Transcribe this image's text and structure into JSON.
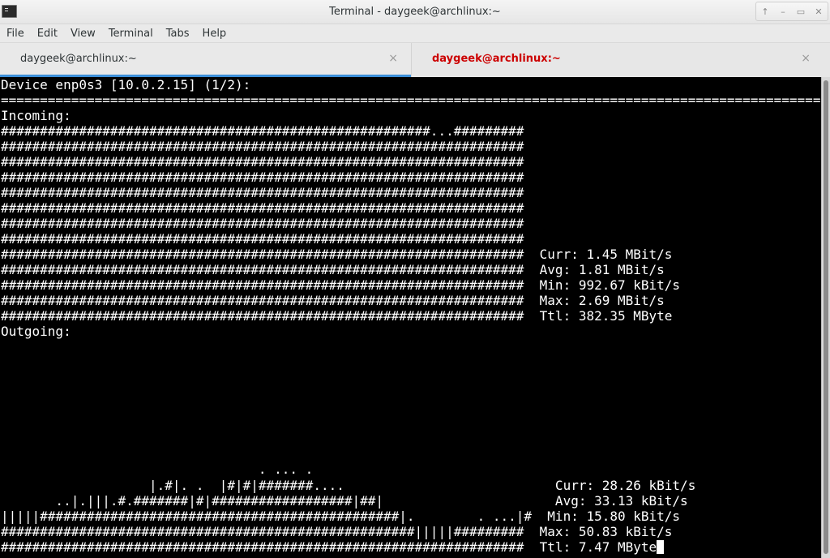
{
  "window": {
    "title": "Terminal - daygeek@archlinux:~",
    "controls": [
      "↑",
      "–",
      "▭",
      "✕"
    ]
  },
  "menubar": {
    "items": [
      "File",
      "Edit",
      "View",
      "Terminal",
      "Tabs",
      "Help"
    ]
  },
  "tabs": [
    {
      "label": "daygeek@archlinux:~",
      "active": true
    },
    {
      "label": "daygeek@archlinux:~",
      "active": false,
      "color": "#cc0000"
    }
  ],
  "tab_close_glyph": "×",
  "terminal": {
    "foreground": "#ffffff",
    "background": "#000000",
    "lines": [
      "Device enp0s3 [10.0.2.15] (1/2):",
      "================================================================================================================",
      "Incoming:",
      "#######################################################...#########",
      "###################################################################",
      "###################################################################",
      "###################################################################",
      "###################################################################",
      "###################################################################",
      "###################################################################",
      "###################################################################",
      "###################################################################  Curr: 1.45 MBit/s",
      "###################################################################  Avg: 1.81 MBit/s",
      "###################################################################  Min: 992.67 kBit/s",
      "###################################################################  Max: 2.69 MBit/s",
      "###################################################################  Ttl: 382.35 MByte",
      "Outgoing:",
      "",
      "",
      "",
      "",
      "",
      "",
      "",
      "                                 . ... .",
      "                   |.#|. .  |#|#|#######....                           Curr: 28.26 kBit/s",
      "       ..|.|||.#.#######|#|##################|##|                      Avg: 33.13 kBit/s",
      "|||||##############################################|.        . ...|#  Min: 15.80 kBit/s",
      "#####################################################|||||#########  Max: 50.83 kBit/s",
      "###################################################################  Ttl: 7.47 MByte"
    ]
  }
}
